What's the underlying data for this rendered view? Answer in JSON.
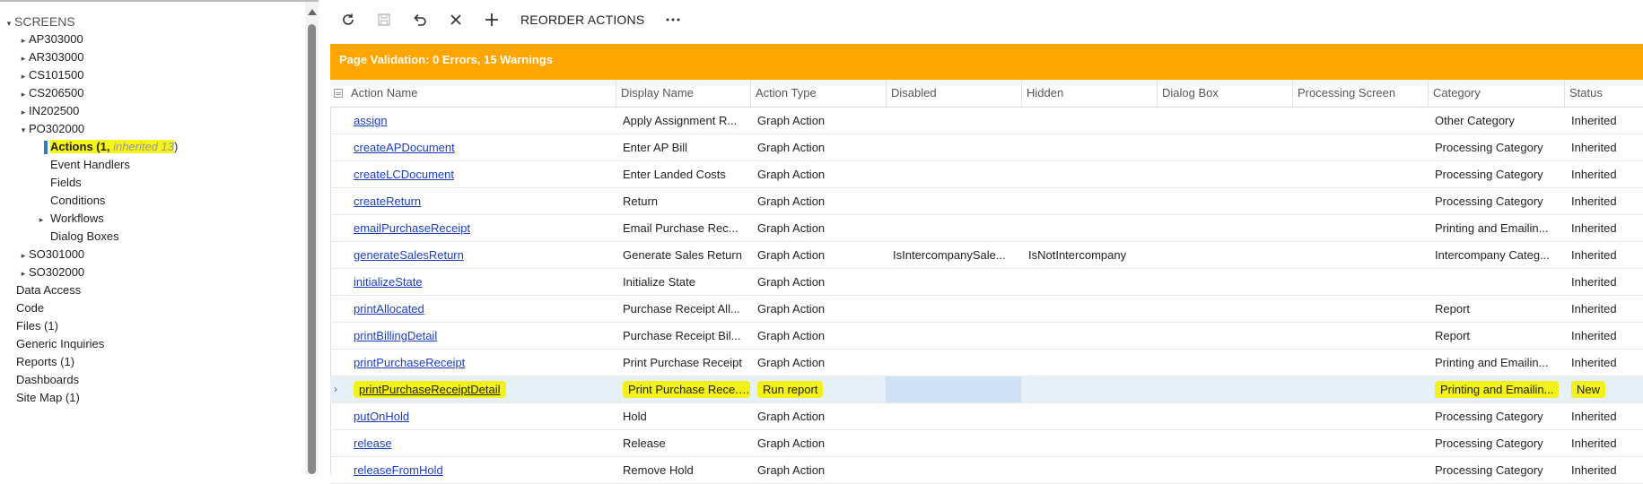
{
  "sidebar": {
    "root": "SCREENS",
    "items": [
      {
        "label": "AP303000"
      },
      {
        "label": "AR303000"
      },
      {
        "label": "CS101500"
      },
      {
        "label": "CS206500"
      },
      {
        "label": "IN202500"
      },
      {
        "label": "PO302000"
      },
      {
        "label_main": "Actions (1,",
        "label_inherited": " inherited 13",
        "label_close": ")"
      },
      {
        "label": "Event Handlers"
      },
      {
        "label": "Fields"
      },
      {
        "label": "Conditions"
      },
      {
        "label": "Workflows"
      },
      {
        "label": "Dialog Boxes"
      },
      {
        "label": "SO301000"
      },
      {
        "label": "SO302000"
      },
      {
        "label": "Data Access"
      },
      {
        "label": "Code"
      },
      {
        "label": "Files (1)"
      },
      {
        "label": "Generic Inquiries"
      },
      {
        "label": "Reports (1)"
      },
      {
        "label": "Dashboards"
      },
      {
        "label": "Site Map (1)"
      }
    ]
  },
  "toolbar": {
    "refresh_icon": "refresh-icon",
    "save_icon": "save-icon",
    "undo_icon": "undo-icon",
    "close_icon": "close-icon",
    "add_icon": "plus-icon",
    "reorder_label": "REORDER ACTIONS",
    "more_icon": "more-icon"
  },
  "validation": {
    "text": "Page Validation: 0 Errors, 15 Warnings",
    "color": "#ffa500"
  },
  "grid": {
    "headers": [
      "Action Name",
      "Display Name",
      "Action Type",
      "Disabled",
      "Hidden",
      "Dialog Box",
      "Processing Screen",
      "Category",
      "Status"
    ],
    "rows": [
      {
        "name": "assign",
        "display": "Apply Assignment R...",
        "type": "Graph Action",
        "disabled": "",
        "hidden": "",
        "category": "Other Category",
        "status": "Inherited"
      },
      {
        "name": "createAPDocument",
        "display": "Enter AP Bill",
        "type": "Graph Action",
        "disabled": "",
        "hidden": "",
        "category": "Processing Category",
        "status": "Inherited"
      },
      {
        "name": "createLCDocument",
        "display": "Enter Landed Costs",
        "type": "Graph Action",
        "disabled": "",
        "hidden": "",
        "category": "Processing Category",
        "status": "Inherited"
      },
      {
        "name": "createReturn",
        "display": "Return",
        "type": "Graph Action",
        "disabled": "",
        "hidden": "",
        "category": "Processing Category",
        "status": "Inherited"
      },
      {
        "name": "emailPurchaseReceipt",
        "display": "Email Purchase Rec...",
        "type": "Graph Action",
        "disabled": "",
        "hidden": "",
        "category": "Printing and Emailin...",
        "status": "Inherited"
      },
      {
        "name": "generateSalesReturn",
        "display": "Generate Sales Return",
        "type": "Graph Action",
        "disabled": "IsIntercompanySale...",
        "hidden": "IsNotIntercompany",
        "category": "Intercompany Categ...",
        "status": "Inherited"
      },
      {
        "name": "initializeState",
        "display": "Initialize State",
        "type": "Graph Action",
        "disabled": "",
        "hidden": "",
        "category": "",
        "status": "Inherited"
      },
      {
        "name": "printAllocated",
        "display": "Purchase Receipt All...",
        "type": "Graph Action",
        "disabled": "",
        "hidden": "",
        "category": "Report",
        "status": "Inherited"
      },
      {
        "name": "printBillingDetail",
        "display": "Purchase Receipt Bil...",
        "type": "Graph Action",
        "disabled": "",
        "hidden": "",
        "category": "Report",
        "status": "Inherited"
      },
      {
        "name": "printPurchaseReceipt",
        "display": "Print Purchase Receipt",
        "type": "Graph Action",
        "disabled": "",
        "hidden": "",
        "category": "Printing and Emailin...",
        "status": "Inherited"
      },
      {
        "name": "printPurchaseReceiptDetail",
        "display": "Print Purchase Rece...",
        "type": "Run report",
        "disabled": "",
        "hidden": "",
        "category": "Printing and Emailin...",
        "status": "New"
      },
      {
        "name": "putOnHold",
        "display": "Hold",
        "type": "Graph Action",
        "disabled": "",
        "hidden": "",
        "category": "Processing Category",
        "status": "Inherited"
      },
      {
        "name": "release",
        "display": "Release",
        "type": "Graph Action",
        "disabled": "",
        "hidden": "",
        "category": "Processing Category",
        "status": "Inherited"
      },
      {
        "name": "releaseFromHold",
        "display": "Remove Hold",
        "type": "Graph Action",
        "disabled": "",
        "hidden": "",
        "category": "Processing Category",
        "status": "Inherited"
      }
    ]
  }
}
